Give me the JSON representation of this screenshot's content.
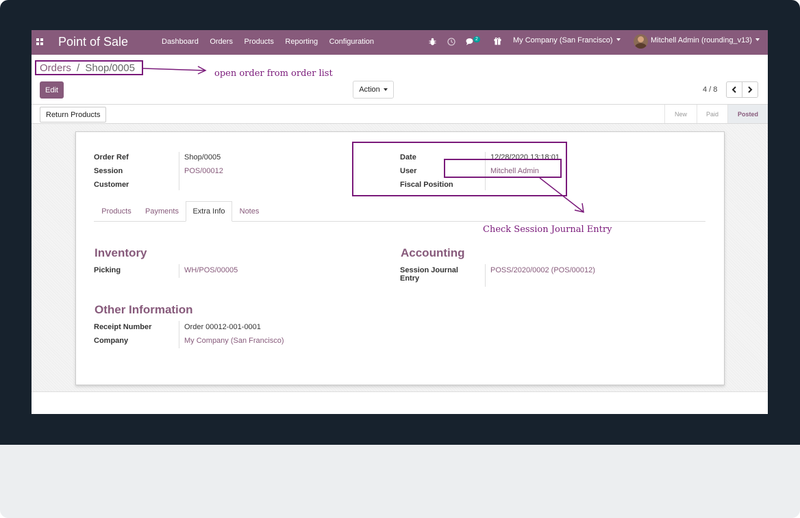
{
  "navbar": {
    "app_title": "Point of Sale",
    "menu": [
      "Dashboard",
      "Orders",
      "Products",
      "Reporting",
      "Configuration"
    ],
    "messages_badge": "2",
    "company": "My Company (San Francisco)",
    "user": "Mitchell Admin (rounding_v13)"
  },
  "breadcrumb": {
    "parent": "Orders",
    "separator": "/",
    "current": "Shop/0005"
  },
  "annotations": {
    "open_order": "open order from order list",
    "check_journal": "Check Session Journal Entry"
  },
  "control": {
    "edit_label": "Edit",
    "action_label": "Action",
    "pager": "4 / 8"
  },
  "statusbar": {
    "return_label": "Return Products",
    "stages": [
      "New",
      "Paid",
      "Posted"
    ],
    "active_stage": "Posted"
  },
  "form": {
    "order_ref_label": "Order Ref",
    "order_ref": "Shop/0005",
    "session_label": "Session",
    "session": "POS/00012",
    "customer_label": "Customer",
    "customer": "",
    "date_label": "Date",
    "date": "12/28/2020 13:18:01",
    "user_label": "User",
    "user": "Mitchell Admin",
    "fiscal_label": "Fiscal Position",
    "fiscal": ""
  },
  "tabs": [
    "Products",
    "Payments",
    "Extra Info",
    "Notes"
  ],
  "active_tab": "Extra Info",
  "extra": {
    "inventory_title": "Inventory",
    "picking_label": "Picking",
    "picking": "WH/POS/00005",
    "other_title": "Other Information",
    "receipt_label": "Receipt Number",
    "receipt": "Order 00012-001-0001",
    "company_label": "Company",
    "company": "My Company (San Francisco)",
    "accounting_title": "Accounting",
    "journal_label_1": "Session Journal",
    "journal_label_2": "Entry",
    "journal": "POSS/2020/0002 (POS/00012)"
  },
  "colors": {
    "brand": "#875a7b",
    "annotation": "#7a1a7a",
    "badge": "#00a09d",
    "bezel": "#17222d"
  }
}
